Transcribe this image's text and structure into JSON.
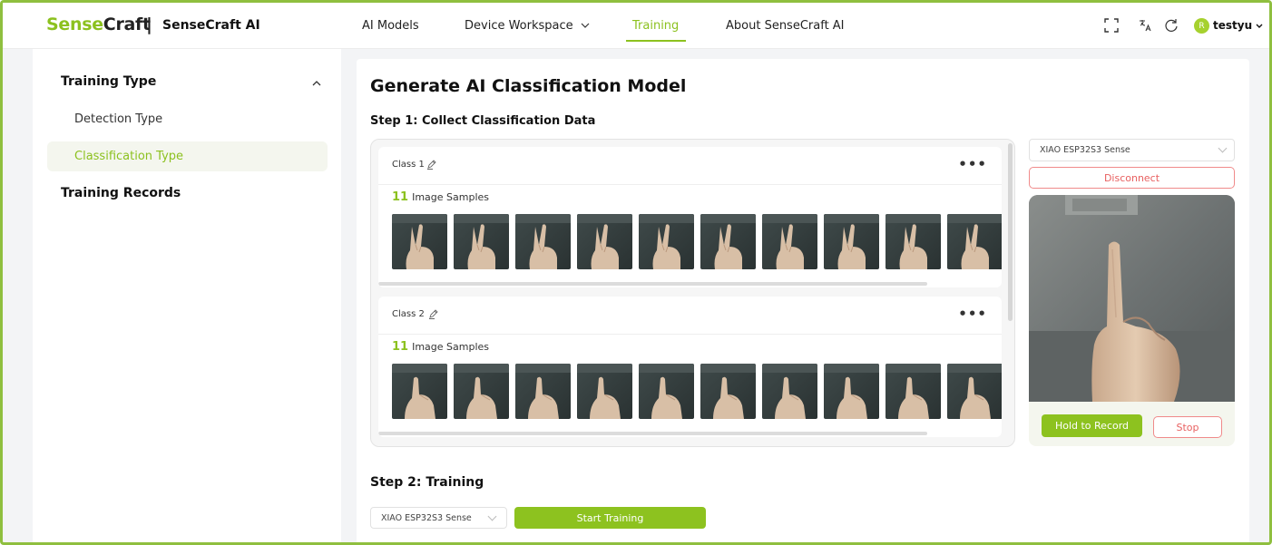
{
  "header": {
    "logo_green": "Sense",
    "logo_dark": "Craft",
    "separator": "|",
    "product": "SenseCraft AI",
    "nav": [
      {
        "label": "AI Models"
      },
      {
        "label": "Device Workspace"
      },
      {
        "label": "Training"
      },
      {
        "label": "About SenseCraft AI"
      }
    ],
    "active_nav": "Training",
    "user": {
      "initial": "R",
      "name": "testyu"
    },
    "icons": [
      "fullscreen-icon",
      "translate-icon",
      "refresh-icon"
    ]
  },
  "sidebar": {
    "section_title": "Training Type",
    "items": [
      {
        "label": "Detection Type",
        "active": false
      },
      {
        "label": "Classification Type",
        "active": true
      }
    ],
    "records_title": "Training Records"
  },
  "main": {
    "title": "Generate AI Classification Model",
    "step1_title": "Step 1: Collect Classification Data",
    "classes": [
      {
        "name": "Class 1",
        "sample_count": "11",
        "sample_label": "Image Samples",
        "gesture": "v-sign"
      },
      {
        "name": "Class 2",
        "sample_count": "11",
        "sample_label": "Image Samples",
        "gesture": "pointing"
      }
    ],
    "more_label": "•••",
    "device": {
      "selected": "XIAO ESP32S3 Sense",
      "disconnect_label": "Disconnect"
    },
    "record_label": "Hold to Record",
    "stop_label": "Stop",
    "step2_title": "Step 2: Training",
    "train_device": "XIAO ESP32S3 Sense",
    "start_training_label": "Start Training"
  },
  "colors": {
    "accent": "#8cc11f",
    "danger": "#e86060",
    "frame": "#8fbf3f"
  }
}
